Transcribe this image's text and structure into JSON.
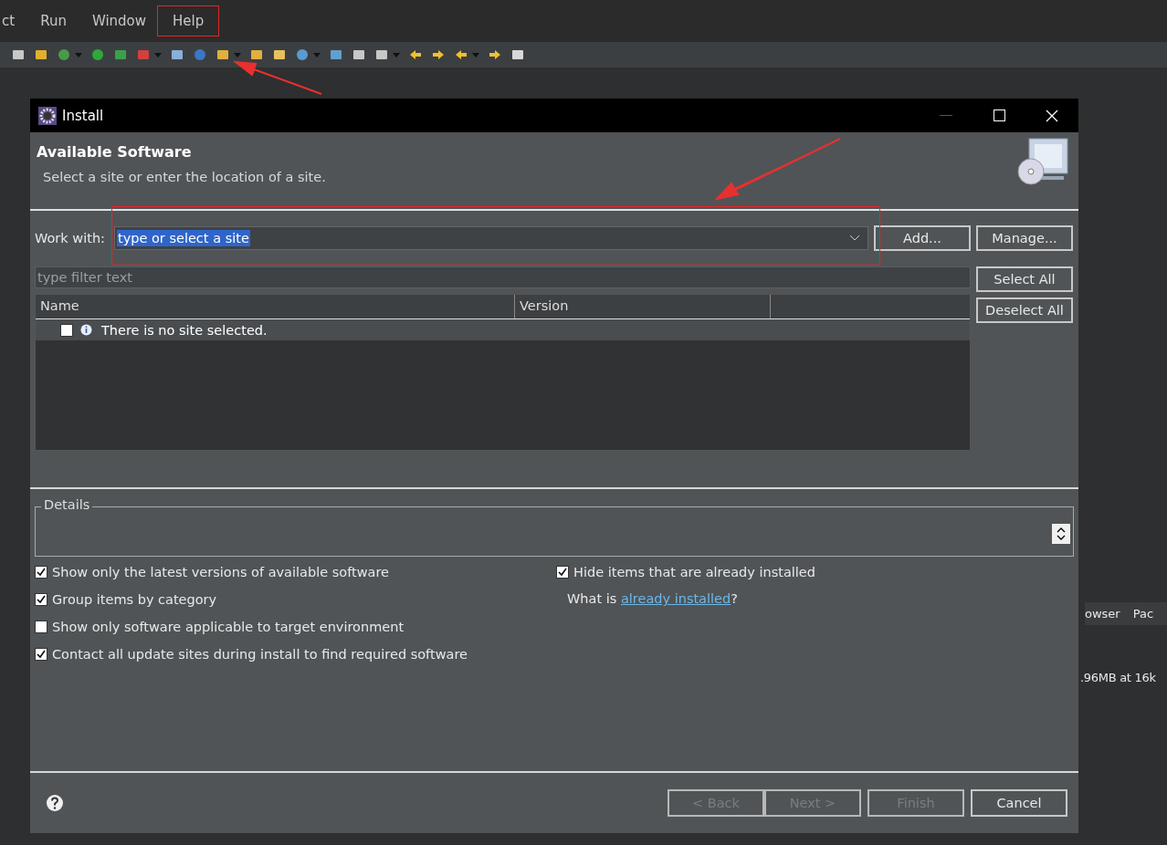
{
  "menu": [
    {
      "label": "ct"
    },
    {
      "label": "Run"
    },
    {
      "label": "Window"
    },
    {
      "label": "Help"
    }
  ],
  "background_tabs": [
    {
      "label": "owser"
    },
    {
      "label": "Pac"
    }
  ],
  "background_text": ".96MB at 16k",
  "dialog": {
    "title": "Install",
    "heading": "Available Software",
    "description": "Select a site or enter the location of a site.",
    "work_with": {
      "label": "Work with:",
      "value": "type or select a site"
    },
    "site_buttons": [
      {
        "label": "Add..."
      },
      {
        "label": "Manage..."
      }
    ],
    "table_buttons": [
      {
        "label": "Select All"
      },
      {
        "label": "Deselect All"
      }
    ],
    "filter": {
      "placeholder": "type filter text"
    },
    "table": {
      "columns": [
        "Name",
        "Version"
      ],
      "rows": [
        {
          "checked": false,
          "text": "There is no site selected."
        }
      ]
    },
    "details": {
      "label": "Details"
    },
    "options_left": [
      {
        "label": "Show only the latest versions of available software",
        "checked": true
      },
      {
        "label": "Group items by category",
        "checked": true
      },
      {
        "label": "Show only software applicable to target environment",
        "checked": false
      },
      {
        "label": "Contact all update sites during install to find required software",
        "checked": true
      }
    ],
    "options_right": [
      {
        "label": "Hide items that are already installed",
        "checked": true
      }
    ],
    "installed_link": {
      "before": "What is ",
      "link": "already installed",
      "after": "?"
    },
    "nav_buttons": [
      {
        "label": "< Back",
        "disabled": true
      },
      {
        "label": "Next >",
        "disabled": true
      },
      {
        "label": "Finish",
        "disabled": true
      },
      {
        "label": "Cancel",
        "disabled": false
      }
    ]
  }
}
